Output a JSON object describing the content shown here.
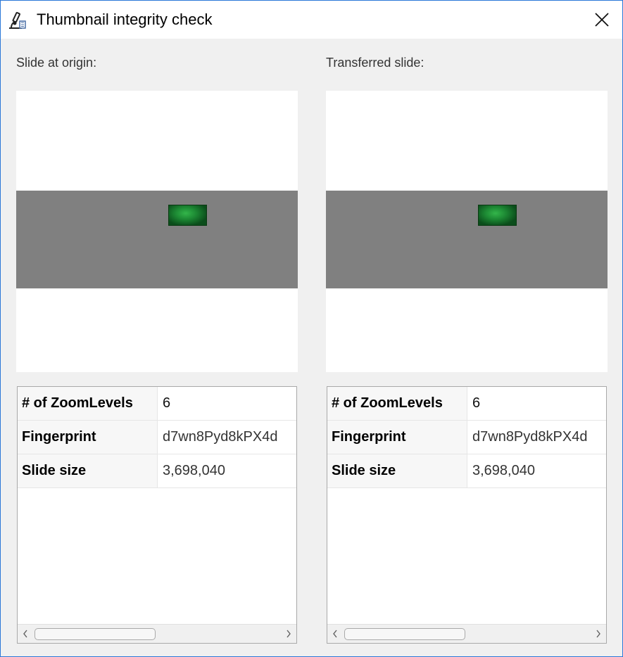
{
  "window": {
    "title": "Thumbnail integrity check",
    "app_icon": "microscope-icon",
    "close_icon": "close-icon",
    "accent_color": "#2b78d8"
  },
  "origin": {
    "label": "Slide at origin:",
    "thumbnail_band_color": "#808080",
    "properties": [
      {
        "key": "# of ZoomLevels",
        "value": "6"
      },
      {
        "key": "Fingerprint",
        "value": "d7wn8Pyd8kPX4d"
      },
      {
        "key": "Slide size",
        "value": "3,698,040"
      }
    ]
  },
  "transferred": {
    "label": "Transferred slide:",
    "thumbnail_band_color": "#808080",
    "properties": [
      {
        "key": "# of ZoomLevels",
        "value": "6"
      },
      {
        "key": "Fingerprint",
        "value": "d7wn8Pyd8kPX4d"
      },
      {
        "key": "Slide size",
        "value": "3,698,040"
      }
    ]
  }
}
